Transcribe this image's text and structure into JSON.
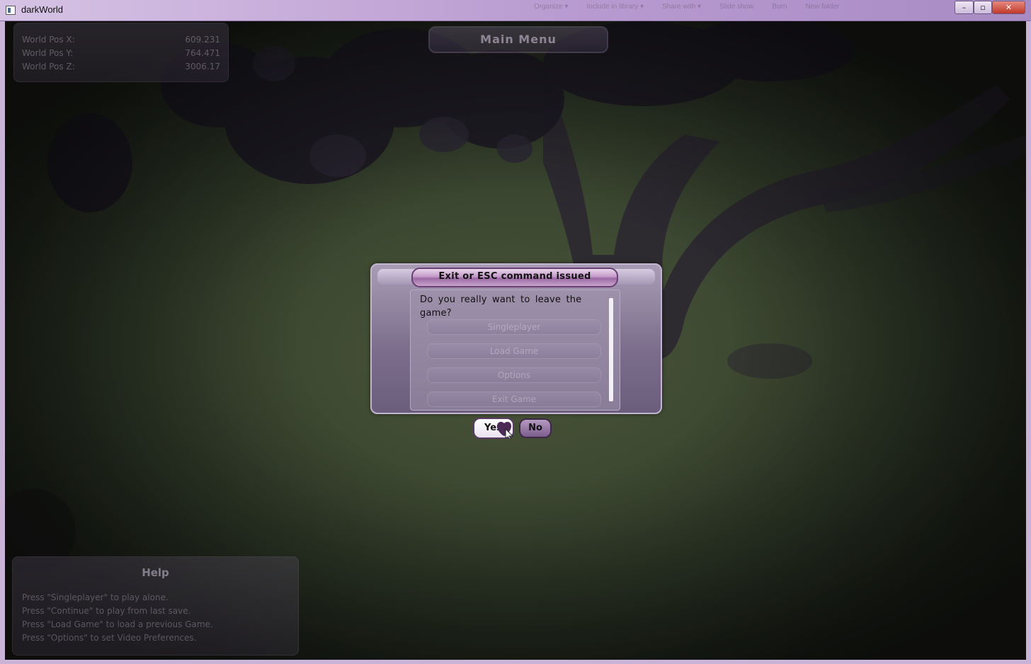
{
  "window": {
    "title": "darkWorld",
    "toolbar_ghost": [
      "Organize ▾",
      "Include in library ▾",
      "Share with ▾",
      "Slide show",
      "Burn",
      "New folder"
    ],
    "minimize": "–",
    "maximize": "▫",
    "close": "✕"
  },
  "world_pos": [
    {
      "label": "World Pos X:",
      "value": "609.231"
    },
    {
      "label": "World Pos Y:",
      "value": "764.471"
    },
    {
      "label": "World Pos Z:",
      "value": "3006.17"
    }
  ],
  "main_menu": {
    "title": "Main Menu",
    "buttons": [
      "Singleplayer",
      "Load Game",
      "Options",
      "Exit Game"
    ]
  },
  "dialog": {
    "title": "Exit or ESC command issued",
    "message": "Do you really want to leave the game?",
    "yes_label": "Yes",
    "no_label": "No"
  },
  "help": {
    "title": "Help",
    "lines": [
      "Press \"Singleplayer\" to play alone.",
      "Press \"Continue\" to play from last save.",
      "Press \"Load Game\" to load a previous Game.",
      "Press \"Options\" to set Video Preferences."
    ]
  },
  "colors": {
    "accent": "#9b6aa4",
    "panel": "#6a5a78",
    "grass": "#4a5538"
  }
}
